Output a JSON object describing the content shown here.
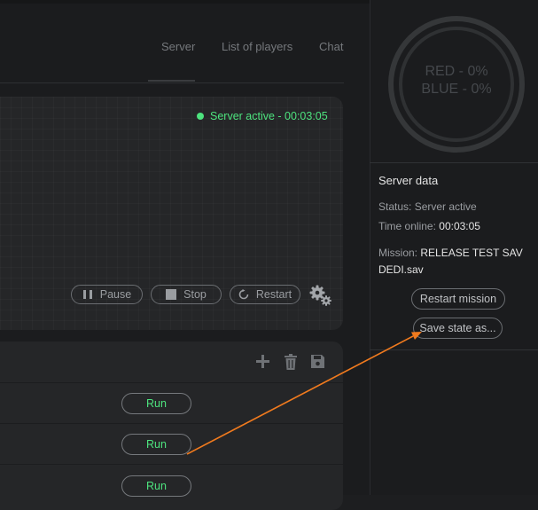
{
  "tabs": [
    {
      "label": "Server"
    },
    {
      "label": "List of players"
    },
    {
      "label": "Chat"
    }
  ],
  "server": {
    "status_text": "Server active - 00:03:05",
    "status_color": "#4de37e",
    "controls": {
      "pause": "Pause",
      "stop": "Stop",
      "restart": "Restart"
    }
  },
  "missions": {
    "run_label": "Run",
    "rows": [
      {
        "run": "Run"
      },
      {
        "run": "Run"
      },
      {
        "run": "Run"
      }
    ],
    "toolbar_icons": [
      "plus-icon",
      "trash-icon",
      "save-icon"
    ]
  },
  "score": {
    "red": "RED - 0%",
    "blue": "BLUE - 0%"
  },
  "server_data": {
    "title": "Server data",
    "status_label": "Status:",
    "status_value": "Server active",
    "time_label": "Time online:",
    "time_value": "00:03:05",
    "mission_label": "Mission:",
    "mission_value_line1": "RELEASE TEST SAV",
    "mission_value_line2": "DEDI.sav",
    "restart_mission": "Restart mission",
    "save_state": "Save state as..."
  },
  "colors": {
    "accent_green": "#4de37e",
    "annotation_arrow": "#f07a1e"
  }
}
